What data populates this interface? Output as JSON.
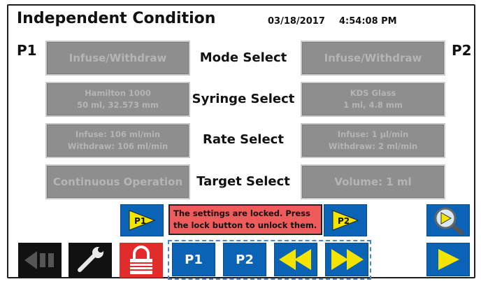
{
  "header": {
    "title": "Independent Condition",
    "date": "03/18/2017",
    "time": "4:54:08 PM"
  },
  "pumps": {
    "p1_label": "P1",
    "p2_label": "P2"
  },
  "rows": [
    {
      "name": "mode",
      "label": "Mode Select",
      "p1": {
        "line1": "Infuse/Withdraw"
      },
      "p2": {
        "line1": "Infuse/Withdraw"
      }
    },
    {
      "name": "syringe",
      "label": "Syringe Select",
      "p1": {
        "line1": "Hamilton 1000",
        "line2": "50 ml, 32.573 mm"
      },
      "p2": {
        "line1": "KDS Glass",
        "line2": "1 ml, 4.8 mm"
      }
    },
    {
      "name": "rate",
      "label": "Rate Select",
      "p1": {
        "line1": "Infuse: 106 ml/min",
        "line2": "Withdraw: 106 ml/min"
      },
      "p2": {
        "line1": "Infuse: 1 µl/min",
        "line2": "Withdraw: 2 ml/min"
      }
    },
    {
      "name": "target",
      "label": "Target Select",
      "p1": {
        "line1": "Continuous Operation"
      },
      "p2": {
        "line1": "Volume: 1 ml"
      }
    }
  ],
  "message": {
    "line1": "The settings are locked. Press",
    "line2": "the lock button to unlock them."
  },
  "controls": {
    "p1_run_label": "P1",
    "p2_run_label": "P2",
    "p1_select_label": "P1",
    "p2_select_label": "P2"
  },
  "icons": {
    "pause": "pause-icon",
    "settings": "wrench-icon",
    "lock": "lock-icon",
    "rewind": "rewind-icon",
    "fast_forward": "fast-forward-icon",
    "search": "magnifier-icon",
    "play": "play-icon"
  },
  "colors": {
    "accent_blue": "#0a63b4",
    "icon_yellow": "#f3e500",
    "locked_red": "#e22b2b",
    "message_red": "#ef5a5a",
    "disabled_gray": "#8e8e8e"
  }
}
